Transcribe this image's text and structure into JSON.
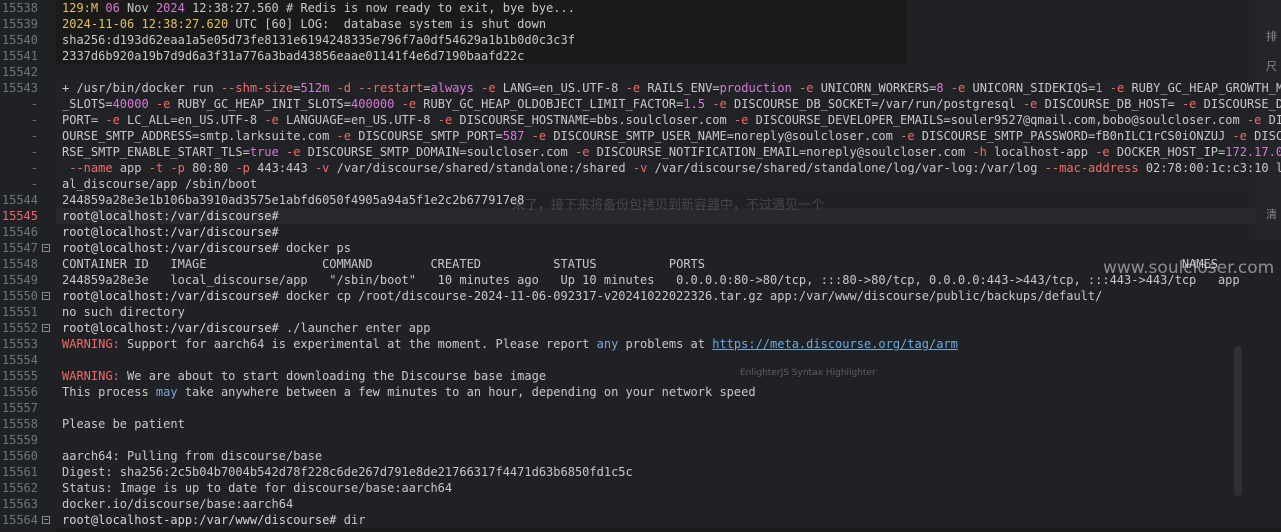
{
  "lines": [
    {
      "n": "15538",
      "text": "129:M 06 Nov 2024 12:38:27.560 # Redis is now ready to exit, bye bye...",
      "fold": false
    },
    {
      "n": "15539",
      "text": "2024-11-06 12:38:27.620 UTC [60] LOG:  database system is shut down",
      "fold": false
    },
    {
      "n": "15540",
      "text": "sha256:d193d62eaa1a5e05d73fe8131e6194248335e796f7a0df54629a1b1b0d0c3c3f",
      "fold": false
    },
    {
      "n": "15541",
      "text": "2337d6b920a19b7d9d6a3f31a776a3bad43856eaae01141f4e6d7190baafd22c",
      "fold": false
    },
    {
      "n": "15542",
      "text": "",
      "fold": false
    },
    {
      "n": "15543",
      "text": "+ /usr/bin/docker run --shm-size=512m -d --restart=always -e LANG=en_US.UTF-8 -e RAILS_ENV=production -e UNICORN_WORKERS=8 -e UNICORN_SIDEKIQS=1 -e RUBY_GC_HEAP_GROWTH_MAX",
      "fold": false
    },
    {
      "n": "-",
      "text": "_SLOTS=40000 -e RUBY_GC_HEAP_INIT_SLOTS=400000 -e RUBY_GC_HEAP_OLDOBJECT_LIMIT_FACTOR=1.5 -e DISCOURSE_DB_SOCKET=/var/run/postgresql -e DISCOURSE_DB_HOST= -e DISCOURSE_DB_",
      "fold": false
    },
    {
      "n": "-",
      "text": "PORT= -e LC_ALL=en_US.UTF-8 -e LANGUAGE=en_US.UTF-8 -e DISCOURSE_HOSTNAME=bbs.soulcloser.com -e DISCOURSE_DEVELOPER_EMAILS=souler9527@qmail.com,bobo@soulcloser.com -e DISC",
      "fold": false
    },
    {
      "n": "-",
      "text": "OURSE_SMTP_ADDRESS=smtp.larksuite.com -e DISCOURSE_SMTP_PORT=587 -e DISCOURSE_SMTP_USER_NAME=noreply@soulcloser.com -e DISCOURSE_SMTP_PASSWORD=fB0nILC1rCS0iONZUJ -e DISCOU",
      "fold": false
    },
    {
      "n": "-",
      "text": "RSE_SMTP_ENABLE_START_TLS=true -e DISCOURSE_SMTP_DOMAIN=soulcloser.com -e DISCOURSE_NOTIFICATION_EMAIL=noreply@soulcloser.com -h localhost-app -e DOCKER_HOST_IP=172.17.0.1",
      "fold": false
    },
    {
      "n": "-",
      "text": " --name app -t -p 80:80 -p 443:443 -v /var/discourse/shared/standalone:/shared -v /var/discourse/shared/standalone/log/var-log:/var/log --mac-address 02:78:00:1c:c3:10 loc",
      "fold": false
    },
    {
      "n": "-",
      "text": "al_discourse/app /sbin/boot",
      "fold": false
    },
    {
      "n": "15544",
      "text": "244859a28e3e1b106ba3910ad3575e1abfd6050f4905a94a5f1e2c2b677917e8",
      "fold": false
    },
    {
      "n": "15545",
      "text": "root@localhost:/var/discourse#",
      "fold": false
    },
    {
      "n": "15546",
      "text": "root@localhost:/var/discourse#",
      "fold": false
    },
    {
      "n": "15547",
      "text": "root@localhost:/var/discourse# docker ps",
      "fold": true
    },
    {
      "n": "15548",
      "text": "CONTAINER ID   IMAGE                COMMAND        CREATED          STATUS          PORTS                                                                  NAMES",
      "fold": false
    },
    {
      "n": "15549",
      "text": "244859a28e3e   local_discourse/app   \"/sbin/boot\"   10 minutes ago   Up 10 minutes   0.0.0.0:80->80/tcp, :::80->80/tcp, 0.0.0.0:443->443/tcp, :::443->443/tcp   app",
      "fold": false
    },
    {
      "n": "15550",
      "text": "root@localhost:/var/discourse# docker cp /root/discourse-2024-11-06-092317-v20241022022326.tar.gz app:/var/www/discourse/public/backups/default/",
      "fold": true
    },
    {
      "n": "15551",
      "text": "no such directory",
      "fold": false
    },
    {
      "n": "15552",
      "text": "root@localhost:/var/discourse# ./launcher enter app",
      "fold": true
    },
    {
      "n": "15553",
      "text": "WARNING: Support for aarch64 is experimental at the moment. Please report any problems at https://meta.discourse.org/tag/arm",
      "fold": false
    },
    {
      "n": "15554",
      "text": "",
      "fold": false
    },
    {
      "n": "15555",
      "text": "WARNING: We are about to start downloading the Discourse base image",
      "fold": false
    },
    {
      "n": "15556",
      "text": "This process may take anywhere between a few minutes to an hour, depending on your network speed",
      "fold": false
    },
    {
      "n": "15557",
      "text": "",
      "fold": false
    },
    {
      "n": "15558",
      "text": "Please be patient",
      "fold": false
    },
    {
      "n": "15559",
      "text": "",
      "fold": false
    },
    {
      "n": "15560",
      "text": "aarch64: Pulling from discourse/base",
      "fold": false
    },
    {
      "n": "15561",
      "text": "Digest: sha256:2c5b04b7004b542d78f228c6de267d791e8de21766317f4471d63b6850fd1c5c",
      "fold": false
    },
    {
      "n": "15562",
      "text": "Status: Image is up to date for discourse/base:aarch64",
      "fold": false
    },
    {
      "n": "15563",
      "text": "docker.io/discourse/base:aarch64",
      "fold": false
    },
    {
      "n": "15564",
      "text": "root@localhost-app:/var/www/discourse# dir",
      "fold": true
    }
  ],
  "overlay": {
    "watermark": "www.soulcloser.com",
    "names_header": "NAMES",
    "cn_fragment": "来了，接下来将备份包拷贝到新容器中，不过遇见一个",
    "enlighter": "EnlighterJS Syntax Highlighter",
    "side_text_1": "排",
    "side_text_2": "尺",
    "side_text_3": "清"
  },
  "colors": {
    "background": "#1f2124",
    "line_number": "#6e7681",
    "highlight_line_number": "#e06c75",
    "text": "#c8c8c8"
  }
}
